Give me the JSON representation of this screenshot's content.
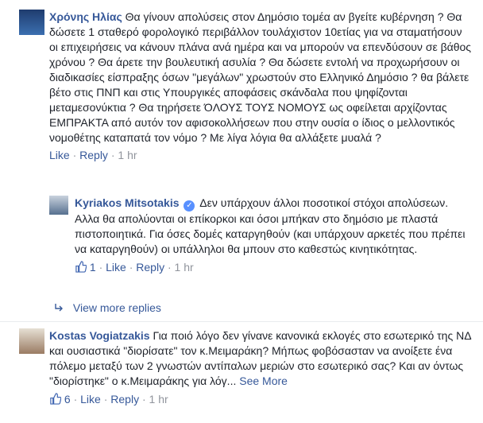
{
  "comments": [
    {
      "author": "Χρόνης Ηλίας",
      "text": "Θα γίνουν απολύσεις στον Δημόσιο τομέα αν βγείτε κυβέρνηση ? Θα δώσετε 1 σταθερό φορολογικό περιβάλλον τουλάχιστον 10ετίας για να σταματήσουν οι επιχειρήσεις να κάνουν πλάνα ανά ημέρα και να μπορούν να επενδύσουν σε βάθος χρόνου ? Θα άρετε την βουλευτική ασυλία ? Θα δώσετε εντολή να προχωρήσουν οι διαδικασίες είσπραξης όσων \"μεγάλων\" χρωστούν στο Ελληνικό Δημόσιο ? θα βάλετε βέτο στις ΠΝΠ και στις Υπουργικές αποφάσεις σκάνδαλα που ψηφίζονται μεταμεσονύκτια ? Θα τηρήσετε ΌΛΟΥΣ ΤΟΥΣ ΝΟΜΟΥΣ ως οφείλεται αρχίζοντας ΕΜΠΡΑΚΤΑ από αυτόν τον αφισοκολλήσεων που στην ουσία ο ίδιος ο μελλοντικός νομοθέτης καταπατά τον νόμο ? Με λίγα λόγια θα αλλάξετε μυαλά ?",
      "like_label": "Like",
      "reply_label": "Reply",
      "time": "1 hr"
    },
    {
      "author": "Kyriakos Mitsotakis",
      "text": "Δεν υπάρχουν άλλοι ποσοτικοί στόχοι απολύσεων. Αλλα θα απολύονται οι επίκορκοι και όσοι μπήκαν στο δημόσιο με πλαστά πιστοποιητικά. Για όσες δομές καταργηθούν (και υπάρχουν αρκετές που πρέπει να καταργηθούν) οι υπάλληλοι θα μπουν στο καθεστώς κινητικότητας.",
      "likes": "1",
      "like_label": "Like",
      "reply_label": "Reply",
      "time": "1 hr"
    },
    {
      "author": "Kostas Vogiatzakis",
      "text": "Για ποιό λόγο δεν γίνανε κανονικά εκλογές στο εσωτερικό της ΝΔ και ουσιαστικά \"διορίσατε\" τον κ.Μειμαράκη? Μήπως φοβόσασταν να ανοίξετε ένα πόλεμο μεταξύ των 2 γνωστών αντίπαλων μεριών στο εσωτερικό σας? Και αν όντως \"διορίστηκε\" ο κ.Μειμαράκης για λόγ...",
      "see_more": "See More",
      "likes": "6",
      "like_label": "Like",
      "reply_label": "Reply",
      "time": "1 hr"
    }
  ],
  "view_more_replies": "View more replies",
  "colors": {
    "link": "#365899",
    "meta": "#90949c",
    "verified": "#5890ff"
  }
}
